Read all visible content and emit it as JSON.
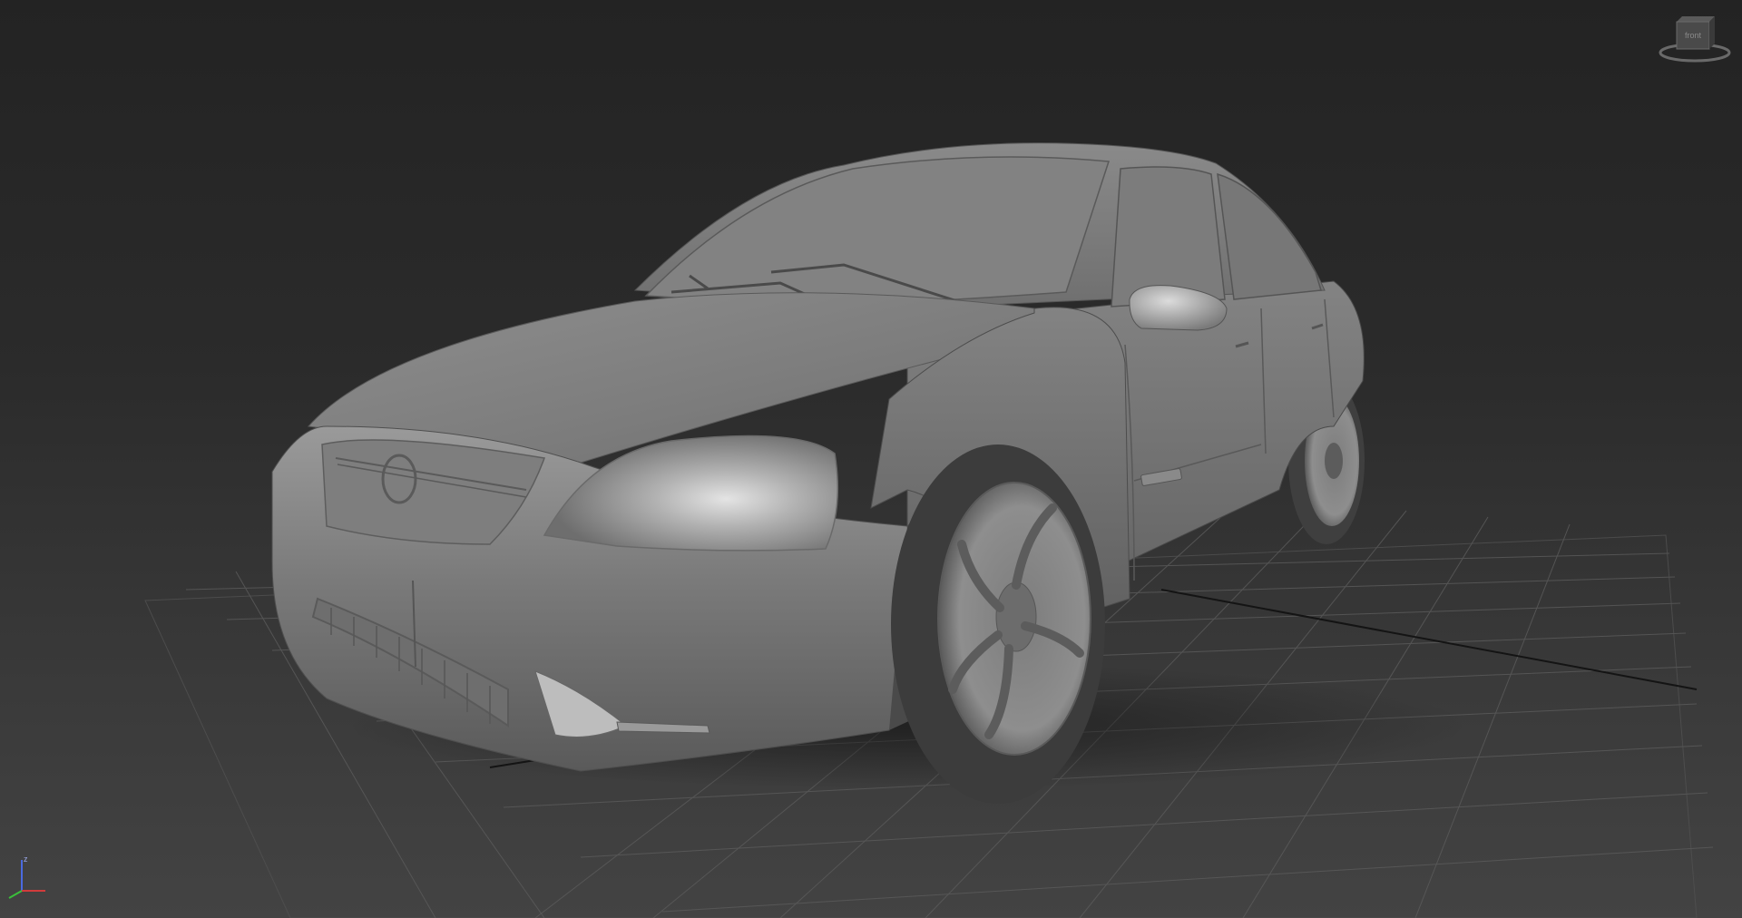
{
  "viewport": {
    "name": "perspective-viewport",
    "shading": "default-shading",
    "background_top": "#232323",
    "background_bottom": "#434343",
    "grid_color": "#5a5a5a",
    "grid_axis_color": "#101010"
  },
  "viewcube": {
    "face_label": "front",
    "icon": "viewcube-icon"
  },
  "axis_tripod": {
    "x_label": "",
    "y_label": "",
    "z_label": "z",
    "x_color": "#d23b3b",
    "y_color": "#3bbf3b",
    "z_color": "#4a6ae0"
  },
  "model": {
    "icon": "sedan-car-model",
    "body_color": "#8c8c8c"
  }
}
